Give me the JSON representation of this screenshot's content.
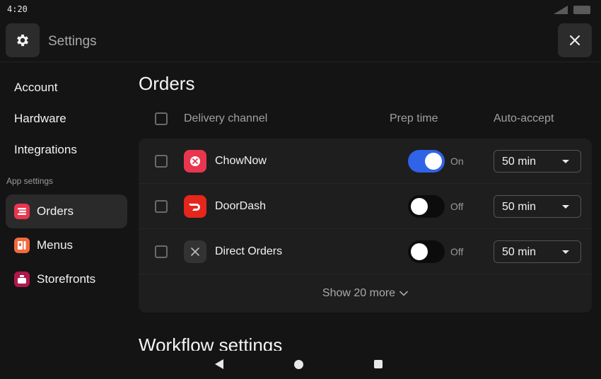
{
  "status_bar": {
    "time": "4:20",
    "signal_icon": "signal-icon",
    "battery_icon": "battery-icon"
  },
  "header": {
    "title": "Settings",
    "settings_icon": "gear-icon",
    "close_icon": "close-icon"
  },
  "sidebar": {
    "links": [
      "Account",
      "Hardware",
      "Integrations"
    ],
    "section_label": "App settings",
    "app_items": [
      {
        "label": "Orders",
        "icon": "orders-icon",
        "color": "#e8364f",
        "active": true
      },
      {
        "label": "Menus",
        "icon": "menus-icon",
        "color": "#f26a3d",
        "active": false
      },
      {
        "label": "Storefronts",
        "icon": "storefronts-icon",
        "color": "#b0184a",
        "active": false
      }
    ]
  },
  "main": {
    "title": "Orders",
    "columns": {
      "channel": "Delivery channel",
      "prep": "Prep time",
      "auto": "Auto-accept"
    },
    "rows": [
      {
        "name": "ChowNow",
        "icon": "chownow-icon",
        "icon_color": "#e8364f",
        "toggle_on": true,
        "toggle_label": "On",
        "value": "50 min"
      },
      {
        "name": "DoorDash",
        "icon": "doordash-icon",
        "icon_color": "#e5261c",
        "toggle_on": false,
        "toggle_label": "Off",
        "value": "50 min"
      },
      {
        "name": "Direct Orders",
        "icon": "utensils-icon",
        "icon_color": "#333333",
        "toggle_on": false,
        "toggle_label": "Off",
        "value": "50 min"
      }
    ],
    "show_more": "Show 20 more",
    "next_section": "Workflow settings"
  },
  "colors": {
    "accent": "#2f63e8",
    "background": "#141414",
    "card": "#1e1e1e"
  },
  "nav": {
    "back_icon": "back-icon",
    "home_icon": "home-icon",
    "recents_icon": "recents-icon"
  }
}
